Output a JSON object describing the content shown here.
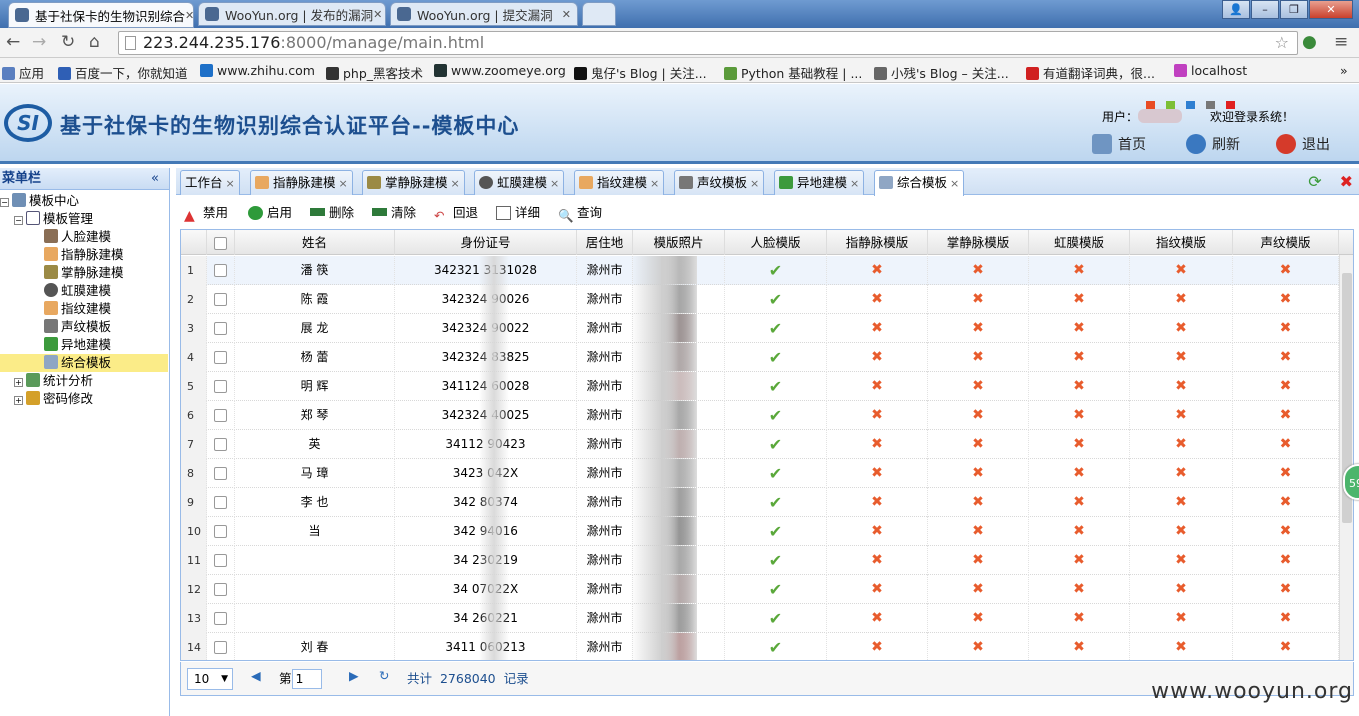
{
  "browser": {
    "tabs": [
      {
        "label": "基于社保卡的生物识别综合"
      },
      {
        "label": "WooYun.org | 发布的漏洞"
      },
      {
        "label": "WooYun.org | 提交漏洞"
      }
    ],
    "url_host": "223.244.235.176",
    "url_path": ":8000/manage/main.html",
    "bookmarks": [
      "应用",
      "百度一下，你就知道",
      "www.zhihu.com",
      "php_黑客技术",
      "www.zoomeye.org",
      "鬼仔's Blog | 关注...",
      "Python 基础教程 | ...",
      "小残's Blog – 关注...",
      "有道翻译词典，很...",
      "localhost"
    ]
  },
  "header": {
    "logo": "SI",
    "title": "基于社保卡的生物识别综合认证平台--模板中心",
    "user_label": "用户：",
    "welcome": "欢迎登录系统！",
    "home": "首页",
    "refresh": "刷新",
    "logout": "退出",
    "theme_colors": [
      "#e84c24",
      "#7cbf36",
      "#2f7fd1",
      "#777777",
      "#e02020"
    ]
  },
  "sidebar": {
    "title": "菜单栏",
    "root": "模板中心",
    "group": "模板管理",
    "items": [
      "人脸建模",
      "指静脉建模",
      "掌静脉建模",
      "虹膜建模",
      "指纹建模",
      "声纹模板",
      "异地建模",
      "综合模板"
    ],
    "extra": [
      "统计分析",
      "密码修改"
    ],
    "selected": "综合模板"
  },
  "tabs": [
    "工作台",
    "指静脉建模",
    "掌静脉建模",
    "虹膜建模",
    "指纹建模",
    "声纹模板",
    "异地建模",
    "综合模板"
  ],
  "active_tab": "综合模板",
  "toolbar": [
    "禁用",
    "启用",
    "删除",
    "清除",
    "回退",
    "详细",
    "查询"
  ],
  "grid": {
    "columns": [
      "姓名",
      "身份证号",
      "居住地",
      "模版照片",
      "人脸模版",
      "指静脉模版",
      "掌静脉模版",
      "虹膜模版",
      "指纹模版",
      "声纹模版"
    ],
    "rows": [
      {
        "n": "1",
        "name": "潘  筷",
        "id": "342321   3131028",
        "city": "滁州市"
      },
      {
        "n": "2",
        "name": "陈  霞",
        "id": "342324   90026",
        "city": "滁州市"
      },
      {
        "n": "3",
        "name": "展  龙",
        "id": "342324   90022",
        "city": "滁州市"
      },
      {
        "n": "4",
        "name": "杨  蕾",
        "id": "342324   83825",
        "city": "滁州市"
      },
      {
        "n": "5",
        "name": "明  辉",
        "id": "341124   60028",
        "city": "滁州市"
      },
      {
        "n": "6",
        "name": "郑  琴",
        "id": "342324   40025",
        "city": "滁州市"
      },
      {
        "n": "7",
        "name": "  英",
        "id": "34112   90423",
        "city": "滁州市"
      },
      {
        "n": "8",
        "name": "马  璋",
        "id": "3423   042X",
        "city": "滁州市"
      },
      {
        "n": "9",
        "name": "李  也",
        "id": "342   80374",
        "city": "滁州市"
      },
      {
        "n": "10",
        "name": "当",
        "id": "342   94016",
        "city": "滁州市"
      },
      {
        "n": "11",
        "name": "",
        "id": "34   230219",
        "city": "滁州市"
      },
      {
        "n": "12",
        "name": "",
        "id": "34   07022X",
        "city": "滁州市"
      },
      {
        "n": "13",
        "name": "",
        "id": "34   260221",
        "city": "滁州市"
      },
      {
        "n": "14",
        "name": "刘  春",
        "id": "3411   060213",
        "city": "滁州市"
      }
    ],
    "face_status": "✔",
    "other_status": "✖"
  },
  "pager": {
    "page_size": "10",
    "page_label": "第",
    "page": "1",
    "total_prefix": "共计",
    "total": "2768040",
    "total_suffix": "记录"
  },
  "float_badge": "59",
  "watermark": "www.wooyun.org"
}
